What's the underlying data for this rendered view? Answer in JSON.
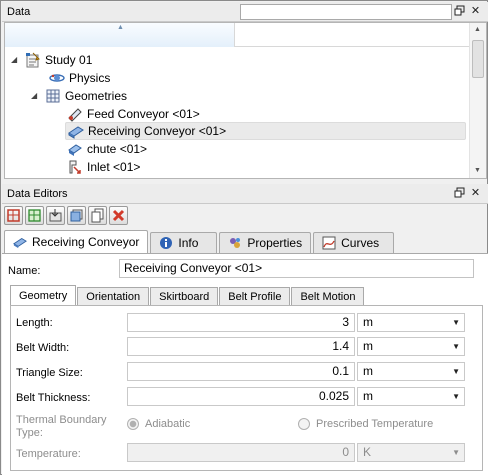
{
  "data_panel": {
    "title": "Data",
    "search_value": "",
    "tree": [
      {
        "label": "Study 01",
        "icon": "study-icon",
        "expanded": true
      },
      {
        "label": "Physics",
        "icon": "physics-icon"
      },
      {
        "label": "Geometries",
        "icon": "geometries-icon",
        "expanded": true
      },
      {
        "label": "Feed Conveyor <01>",
        "icon": "feed-conveyor-icon"
      },
      {
        "label": "Receiving Conveyor <01>",
        "icon": "receiving-conveyor-icon",
        "selected": true
      },
      {
        "label": "chute <01>",
        "icon": "chute-icon"
      },
      {
        "label": "Inlet <01>",
        "icon": "inlet-icon"
      }
    ]
  },
  "editors_panel": {
    "title": "Data Editors",
    "toolbar": [
      "geometry-tool-icon",
      "copy-geometry-icon",
      "import-icon",
      "layers-icon",
      "duplicate-icon",
      "delete-icon"
    ],
    "tabs": [
      {
        "label": "Receiving Conveyor",
        "active": true
      },
      {
        "label": "Info"
      },
      {
        "label": "Properties"
      },
      {
        "label": "Curves"
      }
    ],
    "name_label": "Name:",
    "name_value": "Receiving Conveyor <01>",
    "subtabs": [
      {
        "label": "Geometry",
        "active": true
      },
      {
        "label": "Orientation"
      },
      {
        "label": "Skirtboard"
      },
      {
        "label": "Belt Profile"
      },
      {
        "label": "Belt Motion"
      }
    ],
    "fields": [
      {
        "label": "Length:",
        "value": "3",
        "unit": "m"
      },
      {
        "label": "Belt Width:",
        "value": "1.4",
        "unit": "m"
      },
      {
        "label": "Triangle Size:",
        "value": "0.1",
        "unit": "m"
      },
      {
        "label": "Belt Thickness:",
        "value": "0.025",
        "unit": "m"
      }
    ],
    "thermal": {
      "label_line1": "Thermal Boundary",
      "label_line2": "Type:",
      "option_adiabatic": "Adiabatic",
      "option_prescribed": "Prescribed Temperature",
      "selected": "Adiabatic"
    },
    "temperature": {
      "label": "Temperature:",
      "value": "0",
      "unit": "K"
    }
  },
  "colors": {
    "accent_blue": "#3b6fb6",
    "delete_red": "#d23a2a"
  }
}
